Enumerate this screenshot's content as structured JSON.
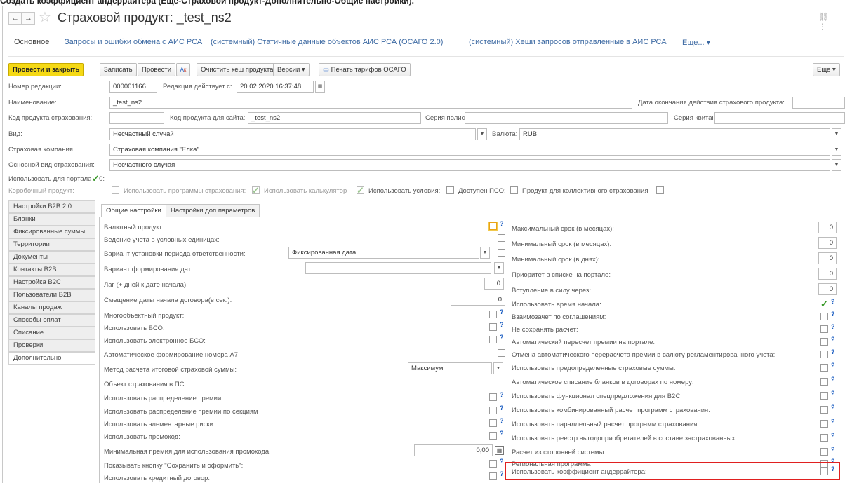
{
  "top_caption": "Создать коэффициент андеррайтера (Ещё-Страховой продукт-Дополнительно-Общие настройки).",
  "window": {
    "title": "Страховой продукт: _test_ns2",
    "back": "←",
    "forward": "→",
    "star": "☆",
    "link_icon": "⛓",
    "menu_icon": "⋮"
  },
  "linkbar": {
    "items": [
      "Основное",
      "Запросы и ошибки обмена с АИС РСА",
      "(системный) Статичные данные объектов АИС РСА (ОСАГО 2.0)",
      "(системный) Хеши запросов отправленные в АИС РСА",
      "Еще... ▾"
    ]
  },
  "toolbar": {
    "post_close": "Провести и закрыть",
    "save": "Записать",
    "post": "Провести",
    "clear_cache": "Очистить кеш продукта",
    "versions": "Версии ▾",
    "print_tariffs": "Печать тарифов ОСАГО",
    "more": "Еще ▾",
    "help": "?"
  },
  "header": {
    "rev_number_label": "Номер редакции:",
    "rev_number": "000001166",
    "effective_label": "Редакция действует с:",
    "effective_value": "20.02.2020 16:37:48",
    "name_label": "Наименование:",
    "name_value": "_test_ns2",
    "end_date_label": "Дата окончания действия страхового продукта:",
    "end_date_value": ".  .",
    "product_code_label": "Код продукта страхования:",
    "site_code_label": "Код продукта для сайта:",
    "site_code_value": "_test_ns2",
    "policy_series_label": "Серия полиса:",
    "receipt_series_label": "Серия квитанции",
    "kind_label": "Вид:",
    "kind_value": "Несчастный случай",
    "currency_label": "Валюта:",
    "currency_value": "RUB",
    "company_label": "Страховая компания",
    "company_value": "Страховая компания \"Елка\"",
    "main_kind_label": "Основной вид страхования:",
    "main_kind_value": "Несчастного случая",
    "portal_label": "Использовать для портала 2.0:",
    "boxed_label": "Коробочный продукт:",
    "boxed_flags": {
      "programs": "Использовать программы страхования:",
      "calculator": "Использовать калькулятор",
      "conditions": "Использовать условия:",
      "pso": "Доступен ПСО:",
      "collective": "Продукт для коллективного страхования"
    }
  },
  "sidebar": {
    "items": [
      "Настройки B2B 2.0",
      "Бланки",
      "Фиксированные суммы",
      "Территории",
      "Документы",
      "Контакты B2B",
      "Настройка B2C",
      "Пользователи B2B",
      "Каналы продаж",
      "Способы оплат",
      "Списание",
      "Проверки",
      "Дополнительно"
    ]
  },
  "tabs": [
    "Общие настройки",
    "Настройки доп.параметров"
  ],
  "left_fields": {
    "currency_product": "Валютный продукт:",
    "conditional_units": "Ведение учета в условных единицах:",
    "liability_period": "Вариант установки периода ответственности:",
    "liability_period_value": "Фиксированная дата",
    "date_formation": "Вариант формирования дат:",
    "lag": "Лаг (+ дней к дате начала):",
    "lag_value": "0",
    "offset": "Смещение даты начала договора(в сек.):",
    "offset_value": "0",
    "multi_object": "Многообъектный продукт:",
    "use_bso": "Использовать БСО:",
    "use_ebso": "Использовать электронное БСО:",
    "auto_a7": "Автоматическое формирование номера А7:",
    "sum_method": "Метод расчета итоговой страховой суммы:",
    "sum_method_value": "Максимум",
    "object_pc": "Объект страхования в ПС:",
    "premium_dist": "Использовать распределение премии:",
    "premium_dist_sections": "Использовать распределение премии по секциям",
    "elementary_risks": "Использовать элементарные риски:",
    "promo": "Использовать промокод:",
    "min_premium": "Минимальная премия для использования промокода",
    "min_premium_value": "0,00",
    "save_button_show": "Показывать кнопку \"Сохранить и оформить\":",
    "credit": "Использовать кредитный договор:"
  },
  "right_fields": {
    "max_term": "Максимальный срок (в месяцах):",
    "min_term_months": "Минимальный срок (в месяцах):",
    "min_term_days": "Минимальный срок (в днях):",
    "priority": "Приоритет в списке на портале:",
    "effective_after": "Вступление в силу через:",
    "use_start_time": "Использовать время начала:",
    "mutual": "Взаимозачет по соглашениям:",
    "no_save_calc": "Не сохранять расчет:",
    "auto_recalc": "Автоматический пересчет премии на портале:",
    "no_auto_currency": "Отмена автоматического перерасчета премии в валюту регламентированного учета:",
    "predef_sums": "Использовать предопределенные страховые суммы:",
    "auto_writeoff": "Автоматическое списание бланков в договорах по номеру:",
    "b2c_func": "Использовать функционал спецпредложения для B2C",
    "combined_calc": "Использовать комбинированный расчет программ страхования:",
    "parallel_calc": "Использовать параллельный расчет программ страхования",
    "beneficiaries": "Использовать реестр выгодоприобретателей в составе застрахованных",
    "external_calc": "Расчет из сторонней системы:",
    "regional": "Региональная программа",
    "underwriter_coef": "Использовать коэффициент андеррайтера:",
    "zero": "0"
  }
}
